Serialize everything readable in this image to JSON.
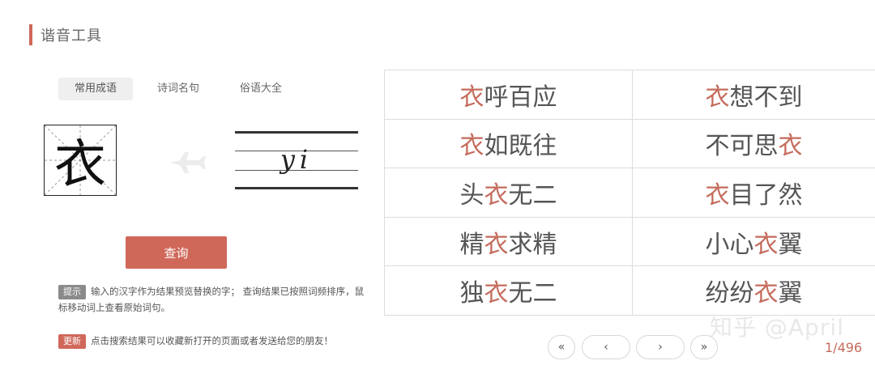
{
  "header": {
    "title": "谐音工具"
  },
  "tabs": [
    {
      "label": "常用成语",
      "active": true
    },
    {
      "label": "诗词名句",
      "active": false
    },
    {
      "label": "俗语大全",
      "active": false
    }
  ],
  "input": {
    "character": "衣",
    "pinyin": "yi"
  },
  "search_button": {
    "label": "查询"
  },
  "hint": {
    "badge": "提示",
    "text": "输入的汉字作为结果预览替换的字； 查询结果已按照词频排序，鼠标移动词上查看原始词句。"
  },
  "update": {
    "badge": "更新",
    "text": "点击搜索结果可以收藏新打开的页面或者发送给您的朋友！"
  },
  "results": [
    {
      "before": "",
      "hl": "衣",
      "after": "呼百应"
    },
    {
      "before": "",
      "hl": "衣",
      "after": "想不到"
    },
    {
      "before": "",
      "hl": "衣",
      "after": "如既往"
    },
    {
      "before": "不可思",
      "hl": "衣",
      "after": ""
    },
    {
      "before": "头",
      "hl": "衣",
      "after": "无二"
    },
    {
      "before": "",
      "hl": "衣",
      "after": "目了然"
    },
    {
      "before": "精",
      "hl": "衣",
      "after": "求精"
    },
    {
      "before": "小心",
      "hl": "衣",
      "after": "翼"
    },
    {
      "before": "独",
      "hl": "衣",
      "after": "无二"
    },
    {
      "before": "纷纷",
      "hl": "衣",
      "after": "翼"
    }
  ],
  "pagination": {
    "first": "«",
    "prev": "‹",
    "next": "›",
    "last": "»",
    "current": "1",
    "total": "496",
    "display": "1/496"
  },
  "watermark": "知乎 @April",
  "colors": {
    "accent": "#d0685a",
    "highlight": "#c56b5c"
  }
}
